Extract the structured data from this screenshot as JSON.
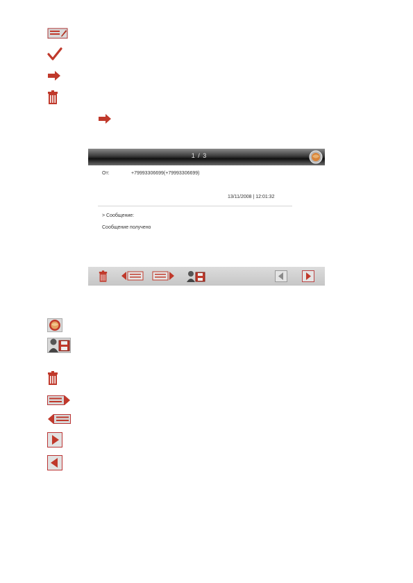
{
  "screenshot": {
    "counter": "1 / 3",
    "from_label": "От:",
    "from_value": "+79993306699(+79993306699)",
    "timestamp": "13/11/2008 | 12:01:32",
    "message_label": "> Сообщение:",
    "message_text": "Сообщение получено"
  },
  "icons": {
    "legend_top": [
      "message-icon",
      "check-icon",
      "forward-arrow-icon",
      "trash-icon"
    ],
    "legend_bottom": [
      "globe-icon",
      "contact-save-icon",
      "trash-icon",
      "next-message-icon",
      "previous-message-icon",
      "right-arrow-icon",
      "left-arrow-icon"
    ]
  },
  "colors": {
    "icon_red": "#c0392b",
    "icon_bg": "#d8d8d8",
    "toolbar": "#cfcfcf"
  }
}
